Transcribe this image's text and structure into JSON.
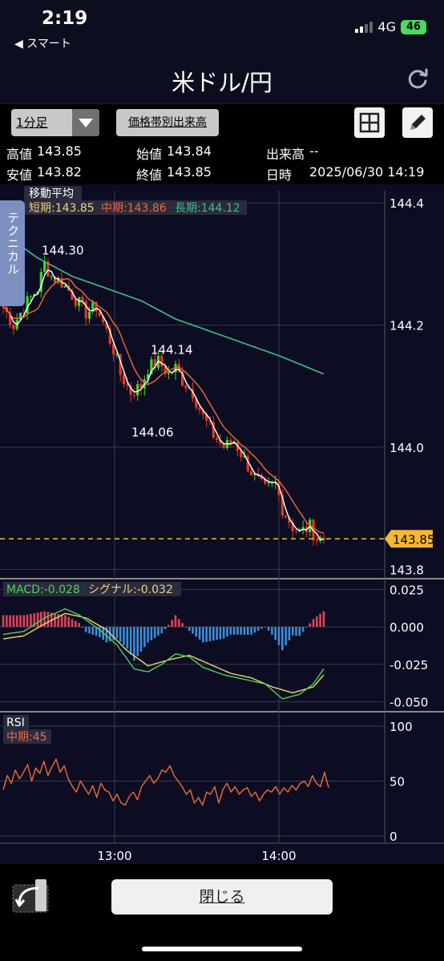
{
  "status": {
    "time": "2:19",
    "back_app": "◀ スマート",
    "network": "4G",
    "battery": "46"
  },
  "nav": {
    "title": "米ドル/円",
    "refresh_icon": "refresh-icon"
  },
  "toolbar": {
    "timeframe": "1分足",
    "volume_profile_label": "価格帯別出来高",
    "layout_icon": "grid-icon",
    "draw_icon": "pencil-icon"
  },
  "quote": {
    "high_label": "高値",
    "high": "143.85",
    "open_label": "始値",
    "open": "143.84",
    "volume_label": "出来高",
    "volume": "--",
    "low_label": "安値",
    "low": "143.82",
    "close_label": "終値",
    "close": "143.85",
    "datetime_label": "日時",
    "datetime": "2025/06/30 14:19"
  },
  "side_tab": "テクニカル",
  "colors": {
    "up": "#3fd62b",
    "down": "#e23a1e",
    "sma_short": "#ffffff",
    "sma_mid": "#ee6a3c",
    "sma_long": "#3fbf82",
    "macd": "#4dd35a",
    "signal": "#f0d279",
    "rsi": "#ee6a3c",
    "current": "#f7b733"
  },
  "chart_data": [
    {
      "type": "candlestick",
      "panel": "price",
      "indicator_title": "移動平均",
      "legend": [
        {
          "text": "短期:143.85",
          "color": "#f0d279"
        },
        {
          "text": "中期:143.86",
          "color": "#ee6a3c"
        },
        {
          "text": "長期:144.12",
          "color": "#3fbf82"
        }
      ],
      "y_ticks": [
        "144.4",
        "144.2",
        "144.0",
        "143.8"
      ],
      "y_tick_values": [
        144.4,
        144.2,
        144.0,
        143.8
      ],
      "ylim": [
        143.79,
        144.42
      ],
      "current_price": "143.85",
      "annotations": [
        {
          "text": "144.30",
          "value": 144.3
        },
        {
          "text": "144.14",
          "value": 144.14
        },
        {
          "text": "144.06",
          "value": 144.06
        }
      ],
      "x_ticks": [
        "13:00",
        "14:00"
      ],
      "close_path": [
        [
          0,
          144.23
        ],
        [
          3,
          144.2
        ],
        [
          6,
          144.23
        ],
        [
          10,
          144.26
        ],
        [
          12,
          144.3
        ],
        [
          14,
          144.28
        ],
        [
          17,
          144.27
        ],
        [
          20,
          144.25
        ],
        [
          24,
          144.22
        ],
        [
          27,
          144.23
        ],
        [
          30,
          144.19
        ],
        [
          32,
          144.16
        ],
        [
          34,
          144.12
        ],
        [
          37,
          144.09
        ],
        [
          40,
          144.1
        ],
        [
          42,
          144.13
        ],
        [
          45,
          144.14
        ],
        [
          48,
          144.12
        ],
        [
          50,
          144.13
        ],
        [
          52,
          144.11
        ],
        [
          55,
          144.09
        ],
        [
          58,
          144.05
        ],
        [
          61,
          144.02
        ],
        [
          64,
          144.0
        ],
        [
          67,
          144.01
        ],
        [
          70,
          143.98
        ],
        [
          73,
          143.95
        ],
        [
          76,
          143.93
        ],
        [
          79,
          143.94
        ],
        [
          81,
          143.9
        ],
        [
          84,
          143.87
        ],
        [
          86,
          143.86
        ],
        [
          89,
          143.87
        ],
        [
          91,
          143.85
        ],
        [
          93,
          143.85
        ]
      ],
      "long_ma_path": [
        [
          0,
          144.35
        ],
        [
          10,
          144.31
        ],
        [
          20,
          144.28
        ],
        [
          30,
          144.26
        ],
        [
          40,
          144.24
        ],
        [
          50,
          144.21
        ],
        [
          60,
          144.19
        ],
        [
          70,
          144.17
        ],
        [
          80,
          144.15
        ],
        [
          93,
          144.12
        ]
      ]
    },
    {
      "type": "macd",
      "legend": [
        {
          "text": "MACD:-0.028",
          "color": "#4dd35a"
        },
        {
          "text": "シグナル:-0.032",
          "color": "#f0d279"
        }
      ],
      "y_ticks": [
        "0.025",
        "0.000",
        "-0.025",
        "-0.050"
      ],
      "y_tick_values": [
        0.025,
        0.0,
        -0.025,
        -0.05
      ],
      "ylim": [
        -0.055,
        0.03
      ],
      "macd_path": [
        [
          0,
          -0.005
        ],
        [
          6,
          -0.003
        ],
        [
          12,
          0.006
        ],
        [
          18,
          0.012
        ],
        [
          22,
          0.008
        ],
        [
          28,
          -0.002
        ],
        [
          33,
          -0.012
        ],
        [
          38,
          -0.028
        ],
        [
          42,
          -0.03
        ],
        [
          46,
          -0.025
        ],
        [
          50,
          -0.018
        ],
        [
          54,
          -0.02
        ],
        [
          58,
          -0.027
        ],
        [
          64,
          -0.032
        ],
        [
          70,
          -0.035
        ],
        [
          76,
          -0.038
        ],
        [
          81,
          -0.048
        ],
        [
          86,
          -0.045
        ],
        [
          90,
          -0.038
        ],
        [
          93,
          -0.028
        ]
      ],
      "signal_path": [
        [
          0,
          -0.008
        ],
        [
          6,
          -0.006
        ],
        [
          12,
          0.002
        ],
        [
          18,
          0.009
        ],
        [
          24,
          0.006
        ],
        [
          30,
          -0.002
        ],
        [
          36,
          -0.016
        ],
        [
          42,
          -0.026
        ],
        [
          48,
          -0.022
        ],
        [
          54,
          -0.019
        ],
        [
          60,
          -0.025
        ],
        [
          66,
          -0.031
        ],
        [
          72,
          -0.034
        ],
        [
          78,
          -0.04
        ],
        [
          84,
          -0.044
        ],
        [
          90,
          -0.04
        ],
        [
          93,
          -0.032
        ]
      ]
    },
    {
      "type": "line",
      "panel": "rsi",
      "indicator_title": "RSI",
      "legend": [
        {
          "text": "中期:45",
          "color": "#ee6a3c"
        }
      ],
      "y_ticks": [
        "100",
        "50",
        "0"
      ],
      "y_tick_values": [
        100,
        50,
        0
      ],
      "ylim": [
        0,
        100
      ],
      "values": [
        42,
        55,
        48,
        60,
        52,
        58,
        65,
        50,
        62,
        57,
        68,
        55,
        63,
        70,
        58,
        64,
        52,
        45,
        40,
        50,
        44,
        38,
        46,
        35,
        48,
        42,
        40,
        32,
        38,
        30,
        28,
        36,
        40,
        33,
        45,
        50,
        55,
        48,
        52,
        60,
        58,
        64,
        55,
        50,
        45,
        38,
        42,
        30,
        35,
        28,
        40,
        38,
        45,
        30,
        42,
        48,
        40,
        45,
        38,
        42,
        44,
        36,
        40,
        32,
        38,
        42,
        40,
        45,
        38,
        44,
        40,
        46,
        42,
        48,
        50,
        45,
        55,
        48,
        45,
        58,
        44
      ],
      "x_ticks": [
        "13:00",
        "14:00"
      ]
    }
  ],
  "footer": {
    "close_label": "閉じる",
    "back_icon": "return-arrow-icon"
  }
}
